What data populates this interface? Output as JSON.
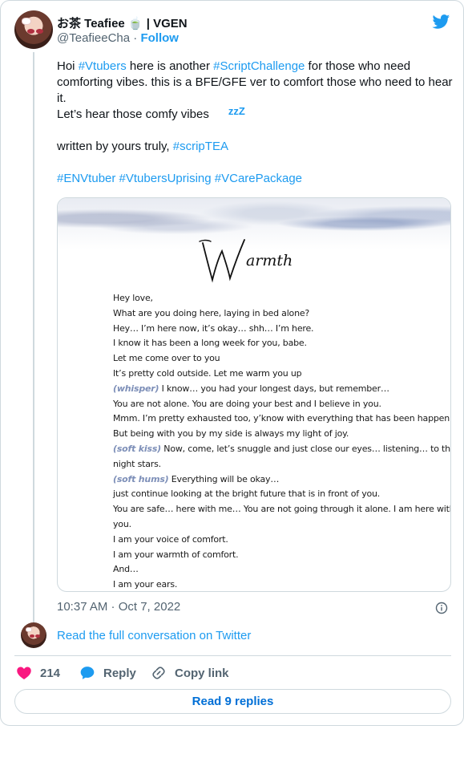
{
  "header": {
    "display_name": "お茶 Teafiee 🍵 | VGEN",
    "handle": "@TeafieeCha",
    "separator": "·",
    "follow_label": "Follow"
  },
  "tweet": {
    "lines": [
      [
        {
          "t": "Hoi "
        },
        {
          "t": "#Vtubers",
          "tag": true
        },
        {
          "t": " here is another "
        },
        {
          "t": "#ScriptChallenge",
          "tag": true
        },
        {
          "t": " for those who need"
        }
      ],
      [
        {
          "t": "comforting vibes.  this is a BFE/GFE ver to comfort those who need to hear"
        }
      ],
      [
        {
          "t": "it."
        }
      ],
      [
        {
          "t": "Let’s hear those comfy vibes"
        },
        {
          "t": "zzZ",
          "zzz": true
        }
      ],
      [],
      [
        {
          "t": "written by yours truly,  "
        },
        {
          "t": "#scripTEA",
          "tag": true
        }
      ],
      [],
      [
        {
          "t": "#ENVtuber",
          "tag": true
        },
        {
          "t": " "
        },
        {
          "t": "#VtubersUprising",
          "tag": true
        },
        {
          "t": "  "
        },
        {
          "t": "#VCarePackage",
          "tag": true
        }
      ]
    ]
  },
  "media": {
    "title": "Warmth",
    "script_lines": [
      [
        {
          "t": "Hey love,"
        }
      ],
      [
        {
          "t": "What are you doing here, laying in bed alone?"
        }
      ],
      [
        {
          "t": "Hey… I’m here now, it’s okay… shh… I’m here."
        }
      ],
      [
        {
          "t": "I know it has been a long week for you, babe."
        }
      ],
      [
        {
          "t": "Let me come over to you"
        }
      ],
      [
        {
          "t": "It’s pretty cold outside. Let me warm you up"
        }
      ],
      [
        {
          "t": "(whisper)",
          "cue": true
        },
        {
          "t": " I know… you had your longest days, but remember…"
        }
      ],
      [
        {
          "t": "You are not alone. You are doing your best and I believe in you."
        }
      ],
      [
        {
          "t": "Mmm. I’m pretty exhausted too, y’know with everything that has been happening."
        }
      ],
      [
        {
          "t": "But being with you by my side is always my light of joy."
        }
      ],
      [
        {
          "t": "(soft kiss)",
          "cue": true
        },
        {
          "t": " Now, come, let’s snuggle and just close our eyes… listening… to the late-"
        }
      ],
      [
        {
          "t": "night stars."
        }
      ],
      [
        {
          "t": "(soft hums)",
          "cue": true
        },
        {
          "t": " Everything will be okay…"
        }
      ],
      [
        {
          "t": "just continue looking at the bright future that is in front of you."
        }
      ],
      [
        {
          "t": "You are safe… here with me… You are not going through it alone. I am here with"
        }
      ],
      [
        {
          "t": "you."
        }
      ],
      [
        {
          "t": "I am your voice of comfort."
        }
      ],
      [
        {
          "t": "I am your warmth of comfort."
        }
      ],
      [
        {
          "t": "And…"
        }
      ],
      [
        {
          "t": "I am your ears."
        }
      ]
    ]
  },
  "timestamp": "10:37 AM · Oct 7, 2022",
  "read_conversation_label": "Read the full conversation on Twitter",
  "actions": {
    "like_count": "214",
    "reply_label": "Reply",
    "copy_label": "Copy link"
  },
  "read_replies_label": "Read 9 replies",
  "colors": {
    "link": "#1d9bf0",
    "like": "#f91880",
    "reply_icon": "#1d9bf0",
    "muted": "#536471",
    "cue": "#7d8fb8"
  }
}
